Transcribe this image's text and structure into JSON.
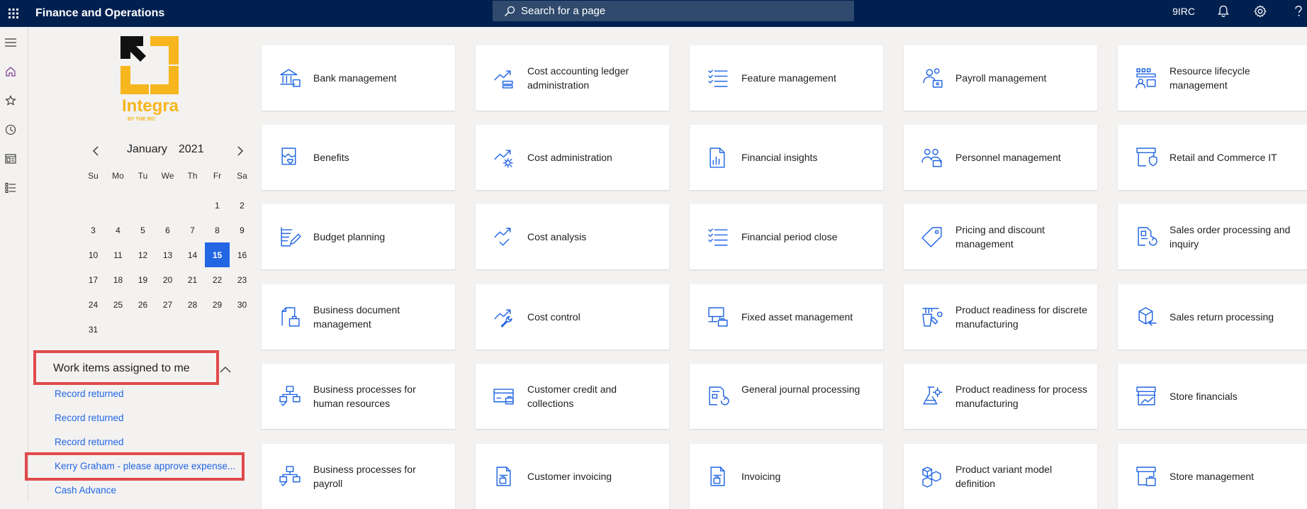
{
  "header": {
    "app_title": "Finance and Operations",
    "search_placeholder": "Search for a page",
    "company": "9IRC"
  },
  "logo": {
    "brand": "Integra",
    "tagline": "BY THE IRC",
    "colors": {
      "gold": "#f7b51e",
      "black": "#111111"
    }
  },
  "calendar": {
    "month": "January",
    "year": "2021",
    "weekdays": [
      "Su",
      "Mo",
      "Tu",
      "We",
      "Th",
      "Fr",
      "Sa"
    ],
    "selected_day": "15",
    "days": [
      "",
      "",
      "",
      "",
      "",
      "1",
      "2",
      "3",
      "4",
      "5",
      "6",
      "7",
      "8",
      "9",
      "10",
      "11",
      "12",
      "13",
      "14",
      "15",
      "16",
      "17",
      "18",
      "19",
      "20",
      "21",
      "22",
      "23",
      "24",
      "25",
      "26",
      "27",
      "28",
      "29",
      "30",
      "31"
    ]
  },
  "work_items": {
    "title": "Work items assigned to me",
    "items": [
      "Record returned",
      "Record returned",
      "Record returned",
      "Kerry Graham - please approve expense...",
      "Cash Advance"
    ]
  },
  "tiles": [
    [
      "Bank management",
      "Cost accounting ledger administration",
      "Feature management",
      "Payroll management",
      "Resource lifecycle management"
    ],
    [
      "Benefits",
      "Cost administration",
      "Financial insights",
      "Personnel management",
      "Retail and Commerce IT"
    ],
    [
      "Budget planning",
      "Cost analysis",
      "Financial period close",
      "Pricing and discount management",
      "Sales order processing and inquiry"
    ],
    [
      "Business document management",
      "Cost control",
      "Fixed asset management",
      "Product readiness for discrete manufacturing",
      "Sales return processing"
    ],
    [
      "Business processes for human resources",
      "Customer credit and collections",
      "General journal processing",
      "Product readiness for process manufacturing",
      "Store financials"
    ],
    [
      "Business processes for payroll",
      "Customer invoicing",
      "Invoicing",
      "Product variant model definition",
      "Store management"
    ]
  ],
  "tile_icons": [
    [
      "bank-icon",
      "trend-ledger-icon",
      "checklist-icon",
      "people-money-icon",
      "resource-lifecycle-icon"
    ],
    [
      "benefits-icon",
      "trend-gear-icon",
      "report-chart-icon",
      "people-group-icon",
      "store-shield-icon"
    ],
    [
      "budget-pencil-icon",
      "trend-check-icon",
      "checklist-icon",
      "price-tag-icon",
      "document-refresh-icon"
    ],
    [
      "document-briefcase-icon",
      "trend-wrench-icon",
      "fixed-asset-icon",
      "factory-tools-icon",
      "box-return-icon"
    ],
    [
      "process-flow-icon",
      "credit-card-icon",
      "journal-refresh-icon",
      "flask-icon",
      "store-chart-icon"
    ],
    [
      "process-flow-icon",
      "invoice-icon",
      "invoice-icon",
      "cubes-icon",
      "store-briefcase-icon"
    ]
  ],
  "colors": {
    "topbar": "#002050",
    "accent": "#2266e3",
    "highlight_border": "#e04a4a",
    "icon": "#2266e3"
  }
}
